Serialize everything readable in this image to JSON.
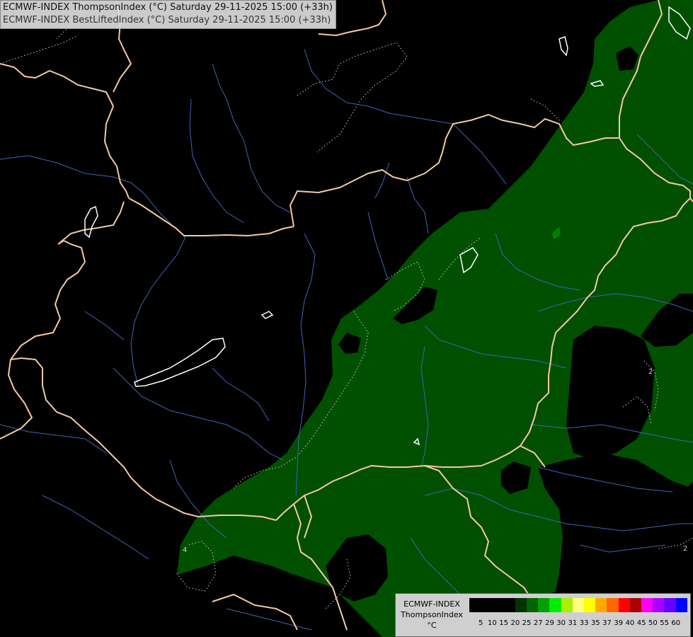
{
  "header": {
    "line1": "ECMWF-INDEX ThompsonIndex (°C) Saturday 29-11-2025 15:00 (+33h)",
    "line2": "ECMWF-INDEX BestLiftedIndex (°C) Saturday 29-11-2025 15:00 (+33h)"
  },
  "legend": {
    "model": "ECMWF-INDEX",
    "parameter": "ThompsonIndex",
    "unit": "°C",
    "colors": [
      "#000000",
      "#000000",
      "#000000",
      "#000000",
      "#003300",
      "#006400",
      "#00a000",
      "#00ee00",
      "#aaee00",
      "#ffff80",
      "#ffff00",
      "#ffaa00",
      "#ff6600",
      "#ff0000",
      "#aa0000",
      "#ff00ff",
      "#aa00ff",
      "#6600ff",
      "#0000ff"
    ],
    "ticks": [
      "5",
      "10",
      "15",
      "20",
      "25",
      "27",
      "29",
      "30",
      "31",
      "33",
      "35",
      "37",
      "39",
      "40",
      "45",
      "50",
      "55",
      "60"
    ]
  },
  "map": {
    "contour_labels": [
      "2",
      "4",
      "2"
    ],
    "colors": {
      "background": "#000000",
      "thompson_fill": "#005000",
      "borders": "#f2c9a0",
      "rivers": "#3f62b8",
      "lakes": "#ffffff"
    }
  }
}
